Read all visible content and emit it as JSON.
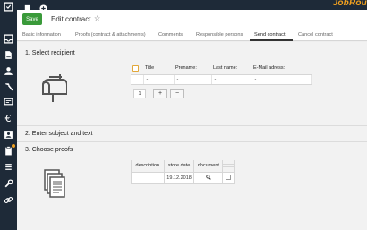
{
  "app": {
    "brand": "JobRou",
    "accent": "#f0a020",
    "sidebar_bg": "#1e2a38"
  },
  "topbar": {
    "icons": [
      "bookmark-icon",
      "plus-circle-icon"
    ]
  },
  "sidebar": {
    "icons": [
      "checkbox-icon",
      "inbox-icon",
      "file-icon",
      "person-icon",
      "hammer-icon",
      "invoice-icon",
      "euro-icon",
      "id-card-icon",
      "clipboard-icon",
      "list-icon",
      "wrench-icon",
      "link-icon"
    ]
  },
  "header": {
    "save_label": "Save",
    "title": "Edit contract",
    "star": "☆"
  },
  "tabs": [
    {
      "label": "Basic information"
    },
    {
      "label": "Proofs (contract & attachments)"
    },
    {
      "label": "Comments"
    },
    {
      "label": "Responsible persons"
    },
    {
      "label": "Send contract",
      "active": true
    },
    {
      "label": "Cancel contract"
    }
  ],
  "sections": {
    "recipient": {
      "title": "1. Select recipient",
      "columns": [
        "Title",
        "Prename:",
        "Last name:",
        "E-Mail adress:"
      ],
      "row": [
        "-",
        "-",
        "-",
        "-"
      ],
      "count": "1",
      "plus": "+",
      "minus": "−"
    },
    "subject": {
      "title": "2. Enter subject and text"
    },
    "proofs": {
      "title": "3. Choose proofs",
      "columns": [
        "description",
        "store date",
        "document"
      ],
      "row": {
        "description": "",
        "store_date": "19.12.2018"
      }
    }
  }
}
